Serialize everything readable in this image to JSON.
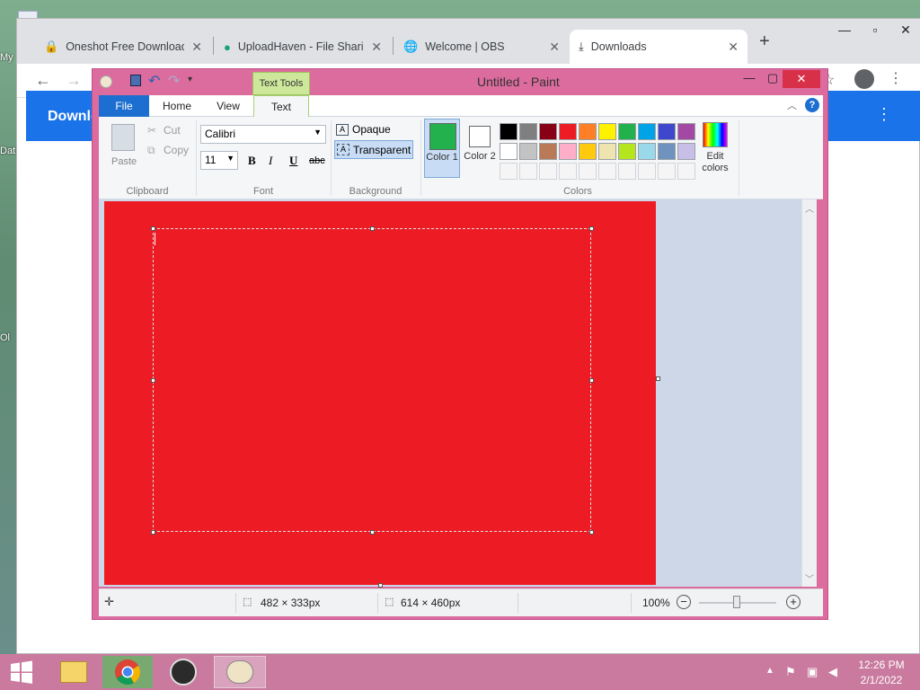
{
  "desktop": {
    "icons": [
      "My",
      "Dat",
      "Ol"
    ]
  },
  "chrome": {
    "tabs": [
      {
        "title": "Oneshot Free Download"
      },
      {
        "title": "UploadHaven - File Sharin"
      },
      {
        "title": "Welcome | OBS"
      },
      {
        "title": "Downloads"
      }
    ],
    "new_tab": "+",
    "page_heading": "Downlo"
  },
  "paint": {
    "title": "Untitled - Paint",
    "context_tab": "Text Tools",
    "tabs": [
      "File",
      "Home",
      "View",
      "Text"
    ],
    "clipboard": {
      "paste": "Paste",
      "cut": "Cut",
      "copy": "Copy",
      "label": "Clipboard"
    },
    "font": {
      "family": "Calibri",
      "size": "11",
      "bold": "B",
      "italic": "I",
      "underline": "U",
      "strike": "abc",
      "label": "Font"
    },
    "background": {
      "opaque": "Opaque",
      "transparent": "Transparent",
      "label": "Background"
    },
    "colors": {
      "color1_label": "Color 1",
      "color2_label": "Color 2",
      "color1": "#22b14c",
      "color2": "#ffffff",
      "edit": "Edit colors",
      "label": "Colors",
      "palette_row1": [
        "#000000",
        "#7f7f7f",
        "#880015",
        "#ed1c24",
        "#ff7f27",
        "#fff200",
        "#22b14c",
        "#00a2e8",
        "#3f48cc",
        "#a349a4"
      ],
      "palette_row2": [
        "#ffffff",
        "#c3c3c3",
        "#b97a57",
        "#ffaec9",
        "#ffc90e",
        "#efe4b0",
        "#b5e61d",
        "#99d9ea",
        "#7092be",
        "#c8bfe7"
      ],
      "palette_row3": [
        "#f5f5f5",
        "#f5f5f5",
        "#f5f5f5",
        "#f5f5f5",
        "#f5f5f5",
        "#f5f5f5",
        "#f5f5f5",
        "#f5f5f5",
        "#f5f5f5",
        "#f5f5f5"
      ]
    },
    "canvas_color": "#ed1c24",
    "status": {
      "selection": "482 × 333px",
      "size": "614 × 460px",
      "zoom": "100%"
    }
  },
  "taskbar": {
    "time": "12:26 PM",
    "date": "2/1/2022"
  }
}
